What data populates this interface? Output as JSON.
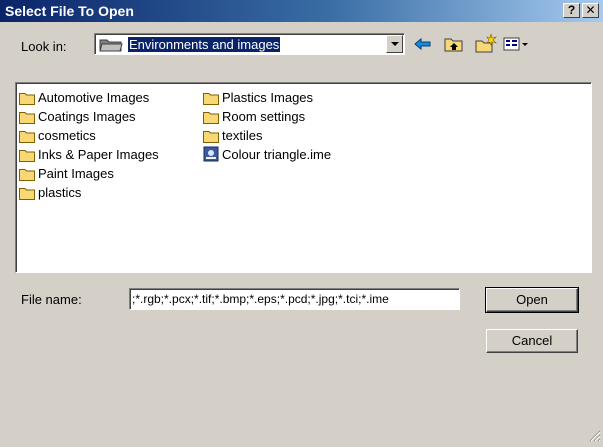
{
  "dialog": {
    "title": "Select File To Open",
    "help_label": "?",
    "close_label": "✕"
  },
  "lookin": {
    "label": "Look in:",
    "value": "Environments and images"
  },
  "toolbar": {
    "back_icon": "back-arrow-icon",
    "up_icon": "up-one-level-icon",
    "new_folder_icon": "new-folder-icon",
    "view_menu_icon": "view-menu-icon"
  },
  "files": {
    "column1": [
      {
        "name": "Automotive Images",
        "type": "folder"
      },
      {
        "name": "Coatings Images",
        "type": "folder"
      },
      {
        "name": "cosmetics",
        "type": "folder"
      },
      {
        "name": "Inks & Paper Images",
        "type": "folder"
      },
      {
        "name": "Paint Images",
        "type": "folder"
      },
      {
        "name": "plastics",
        "type": "folder"
      }
    ],
    "column2": [
      {
        "name": "Plastics Images",
        "type": "folder"
      },
      {
        "name": "Room settings",
        "type": "folder"
      },
      {
        "name": "textiles",
        "type": "folder"
      },
      {
        "name": "Colour triangle.ime",
        "type": "file"
      }
    ]
  },
  "filename": {
    "label": "File name:",
    "value": ";*.rgb;*.pcx;*.tif;*.bmp;*.eps;*.pcd;*.jpg;*.tci;*.ime"
  },
  "buttons": {
    "open": "Open",
    "cancel": "Cancel"
  },
  "colors": {
    "title_bar": "#0a246a",
    "dialog_bg": "#d4d0c8",
    "selection": "#0a246a",
    "folder": "#f8d775"
  }
}
